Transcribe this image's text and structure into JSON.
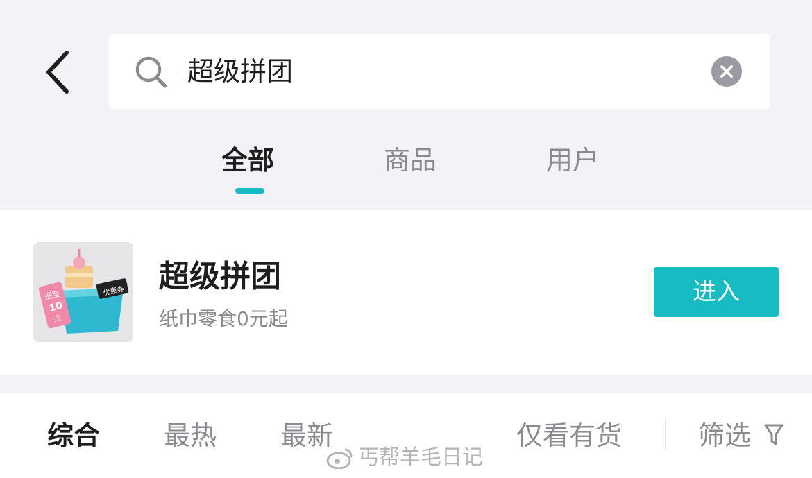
{
  "search": {
    "query": "超级拼团"
  },
  "tabs": [
    {
      "label": "全部",
      "active": true
    },
    {
      "label": "商品",
      "active": false
    },
    {
      "label": "用户",
      "active": false
    }
  ],
  "shop": {
    "title": "超级拼团",
    "subtitle": "纸巾零食0元起",
    "enter_label": "进入",
    "thumb_texts": {
      "coupon": "优惠券",
      "badge_line1": "低至",
      "badge_line2": "10",
      "badge_line3": "元"
    }
  },
  "sort": {
    "options": [
      {
        "label": "综合",
        "active": true
      },
      {
        "label": "最热",
        "active": false
      },
      {
        "label": "最新",
        "active": false
      }
    ],
    "in_stock_label": "仅看有货",
    "filter_label": "筛选"
  },
  "watermark": {
    "text": "丐帮羊毛日记"
  },
  "colors": {
    "accent": "#17bcc2",
    "background": "#f3f3f7"
  },
  "icons": [
    "back-arrow-icon",
    "search-icon",
    "clear-icon",
    "filter-icon",
    "weibo-logo-icon"
  ]
}
